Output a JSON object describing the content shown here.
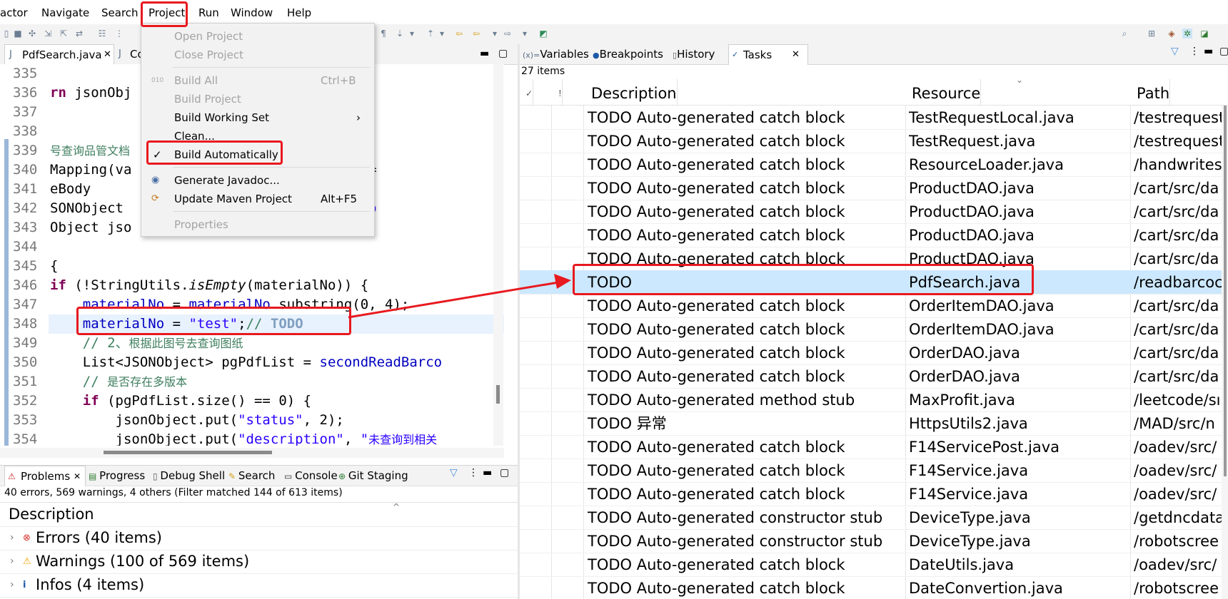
{
  "menubar": [
    "actor",
    "Navigate",
    "Search",
    "Project",
    "Run",
    "Window",
    "Help"
  ],
  "project_menu": {
    "items": [
      {
        "label": "Open Project",
        "disabled": true
      },
      {
        "label": "Close Project",
        "disabled": true
      },
      {
        "label": "Build All",
        "accel": "Ctrl+B",
        "disabled": true
      },
      {
        "label": "Build Project",
        "disabled": true
      },
      {
        "label": "Build Working Set",
        "submenu": true
      },
      {
        "label": "Clean..."
      },
      {
        "label": "Build Automatically",
        "checked": true
      },
      {
        "label": "Generate Javadoc..."
      },
      {
        "label": "Update Maven Project",
        "accel": "Alt+F5"
      },
      {
        "label": "Properties",
        "disabled": true
      }
    ]
  },
  "editor": {
    "tabs": [
      "PdfSearch.java",
      "Co"
    ],
    "lines": [
      {
        "n": "335",
        "code": ""
      },
      {
        "n": "336",
        "code": "rn jsonObj"
      },
      {
        "n": "337",
        "code": ""
      },
      {
        "n": "338",
        "code": ""
      },
      {
        "n": "339",
        "code": "号查询品管文档"
      },
      {
        "n": "340",
        "code": "Mapping(va                  h\", method ="
      },
      {
        "n": "341",
        "code": "eBody"
      },
      {
        "n": "342",
        "code": "SONObject                  m(\"materialNo"
      },
      {
        "n": "343",
        "code": "Object jso                  ();"
      },
      {
        "n": "344",
        "code": ""
      },
      {
        "n": "345",
        "code": "{"
      },
      {
        "n": "346",
        "code": "if (!StringUtils.isEmpty(materialNo)) {"
      },
      {
        "n": "347",
        "code": "    materialNo = materialNo.substring(0, 4);"
      },
      {
        "n": "348",
        "code": "    materialNo = \"test\";// TODO"
      },
      {
        "n": "349",
        "code": "    // 2、根据此图号去查询图纸"
      },
      {
        "n": "350",
        "code": "    List<JSONObject> pgPdfList = secondReadBarco"
      },
      {
        "n": "351",
        "code": "    // 是否存在多版本"
      },
      {
        "n": "352",
        "code": "    if (pgPdfList.size() == 0) {"
      },
      {
        "n": "353",
        "code": "        jsonObject.put(\"status\", 2);"
      },
      {
        "n": "354",
        "code": "        jsonObject.put(\"description\", \"未查询到相关"
      }
    ]
  },
  "problems": {
    "tabs": [
      "Problems",
      "Progress",
      "Debug Shell",
      "Search",
      "Console",
      "Git Staging"
    ],
    "status": "40 errors, 569 warnings, 4 others (Filter matched 144 of 613 items)",
    "header": "Description",
    "rows": [
      "Errors (40 items)",
      "Warnings (100 of 569 items)",
      "Infos (4 items)"
    ]
  },
  "tasks": {
    "tabs": [
      "Variables",
      "Breakpoints",
      "History",
      "Tasks"
    ],
    "count": "27 items",
    "headers": {
      "check": "✓",
      "priority": "!",
      "description": "Description",
      "resource": "Resource",
      "path": "Path"
    },
    "rows": [
      {
        "desc": "TODO Auto-generated catch block",
        "res": "TestRequestLocal.java",
        "path": "/testrequest"
      },
      {
        "desc": "TODO Auto-generated catch block",
        "res": "TestRequest.java",
        "path": "/testrequest"
      },
      {
        "desc": "TODO Auto-generated catch block",
        "res": "ResourceLoader.java",
        "path": "/handwrites"
      },
      {
        "desc": "TODO Auto-generated catch block",
        "res": "ProductDAO.java",
        "path": "/cart/src/da"
      },
      {
        "desc": "TODO Auto-generated catch block",
        "res": "ProductDAO.java",
        "path": "/cart/src/da"
      },
      {
        "desc": "TODO Auto-generated catch block",
        "res": "ProductDAO.java",
        "path": "/cart/src/da"
      },
      {
        "desc": "TODO Auto-generated catch block",
        "res": "ProductDAO.java",
        "path": "/cart/src/da"
      },
      {
        "desc": "TODO",
        "res": "PdfSearch.java",
        "path": "/readbarcoc"
      },
      {
        "desc": "TODO Auto-generated catch block",
        "res": "OrderItemDAO.java",
        "path": "/cart/src/da"
      },
      {
        "desc": "TODO Auto-generated catch block",
        "res": "OrderItemDAO.java",
        "path": "/cart/src/da"
      },
      {
        "desc": "TODO Auto-generated catch block",
        "res": "OrderDAO.java",
        "path": "/cart/src/da"
      },
      {
        "desc": "TODO Auto-generated catch block",
        "res": "OrderDAO.java",
        "path": "/cart/src/da"
      },
      {
        "desc": "TODO Auto-generated method stub",
        "res": "MaxProfit.java",
        "path": "/leetcode/sı"
      },
      {
        "desc": "TODO 异常",
        "res": "HttpsUtils2.java",
        "path": "/MAD/src/n"
      },
      {
        "desc": "TODO Auto-generated catch block",
        "res": "F14ServicePost.java",
        "path": "/oadev/src/"
      },
      {
        "desc": "TODO Auto-generated catch block",
        "res": "F14Service.java",
        "path": "/oadev/src/"
      },
      {
        "desc": "TODO Auto-generated catch block",
        "res": "F14Service.java",
        "path": "/oadev/src/"
      },
      {
        "desc": "TODO Auto-generated constructor stub",
        "res": "DeviceType.java",
        "path": "/getdncdata"
      },
      {
        "desc": "TODO Auto-generated constructor stub",
        "res": "DeviceType.java",
        "path": "/robotscree"
      },
      {
        "desc": "TODO Auto-generated catch block",
        "res": "DateUtils.java",
        "path": "/oadev/src/"
      },
      {
        "desc": "TODO Auto-generated catch block",
        "res": "DateConvertion.java",
        "path": "/robotscree"
      }
    ]
  },
  "colors": {
    "selection": "#cce8ff",
    "annotation_red": "#e8191f",
    "keyword": "#7f0055",
    "string": "#2a00ff",
    "comment": "#3f7f5f"
  }
}
